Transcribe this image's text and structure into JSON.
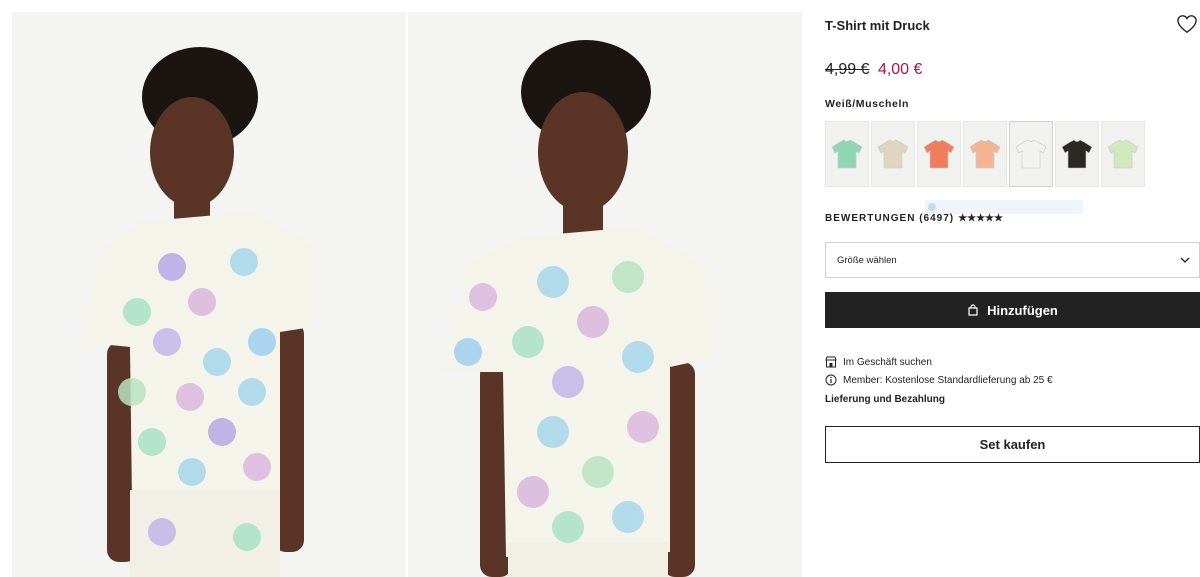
{
  "product": {
    "title": "T-Shirt mit Druck",
    "price_old": "4,99 €",
    "price_new": "4,00 €",
    "color_name": "Weiß/Muscheln",
    "reviews_label": "BEWERTUNGEN (6497)",
    "stars": "★★★★★",
    "size_placeholder": "Größe wählen",
    "add_button": "Hinzufügen",
    "store_search": "Im Geschäft suchen",
    "member_info": "Member: Kostenlose Standardlieferung ab 25 €",
    "delivery_link": "Lieferung und Bezahlung",
    "set_button": "Set kaufen"
  },
  "swatches": [
    {
      "name": "mint-green",
      "color": "#8fd6b4"
    },
    {
      "name": "beige-pattern",
      "color": "#ddd5bf"
    },
    {
      "name": "floral-multicolor",
      "color": "#f07e5a"
    },
    {
      "name": "peach",
      "color": "#f3b494"
    },
    {
      "name": "white-print",
      "color": "#f2f2ee"
    },
    {
      "name": "black-print",
      "color": "#2b2721"
    },
    {
      "name": "light-green-print",
      "color": "#cfe8bd"
    }
  ],
  "icons": {
    "favorite": "heart-icon",
    "size_chevron": "chevron-down-icon",
    "bag": "shopping-bag-icon",
    "store": "store-icon",
    "info": "info-icon"
  },
  "colors": {
    "sale_price": "#b3114a",
    "button_dark": "#222222"
  }
}
